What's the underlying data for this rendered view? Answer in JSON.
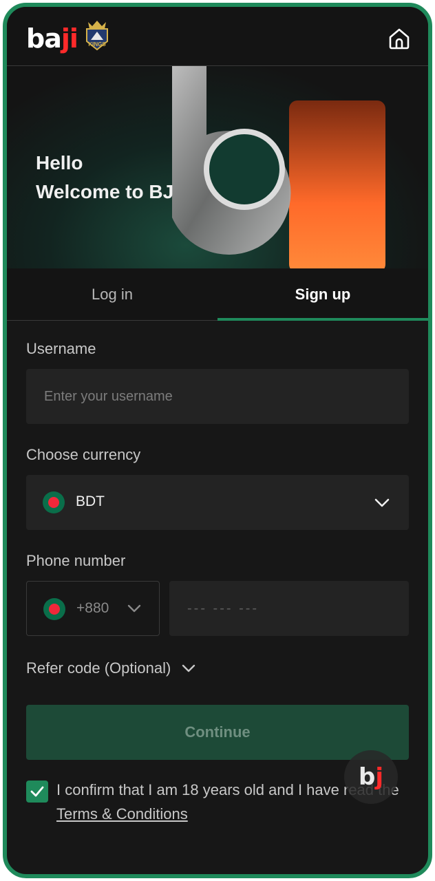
{
  "brand": {
    "logo_main": "ba",
    "logo_accent": "ji",
    "badge_text": "KINGS"
  },
  "hero": {
    "line1": "Hello",
    "line2": "Welcome to BJ"
  },
  "tabs": {
    "login": "Log in",
    "signup": "Sign up",
    "active": "signup"
  },
  "form": {
    "username": {
      "label": "Username",
      "placeholder": "Enter your username"
    },
    "currency": {
      "label": "Choose currency",
      "value": "BDT"
    },
    "phone": {
      "label": "Phone number",
      "country_code": "+880",
      "placeholder": "--- --- ---"
    },
    "refer": {
      "label": "Refer code (Optional)"
    },
    "continue_label": "Continue",
    "confirm": {
      "text_before": "I confirm that I am 18 years old and I have read the ",
      "link": "Terms & Conditions",
      "checked": true
    }
  },
  "floating_button": {
    "main": "b",
    "accent": "j"
  },
  "icons": [
    "home-icon",
    "chevron-down-icon",
    "check-icon",
    "bangladesh-flag-icon"
  ],
  "colors": {
    "accent": "#1f8a5b",
    "background": "#171717",
    "field": "#232323",
    "brand_red": "#ff2a2a"
  }
}
